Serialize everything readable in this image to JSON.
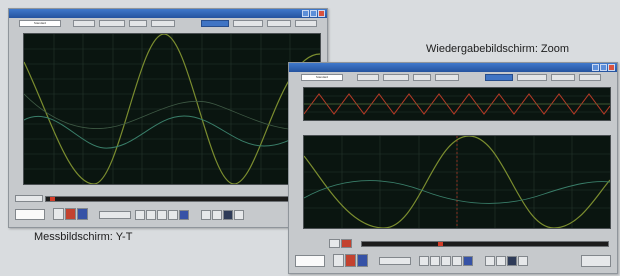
{
  "captions": {
    "measurement": "Messbildschirm: Y-T",
    "playback": "Wiedergabebildschirm: Zoom"
  },
  "colors": {
    "plot_bg": "#0a1510",
    "trace_primary": "#7b8d2f",
    "trace_secondary": "#3a7f6a",
    "trace_red": "#b83a26",
    "title_bar": "#2f63b5",
    "accent_button": "#3f74c4"
  },
  "measurement_window": {
    "toolbar": {
      "selected_tab": "Standard"
    },
    "icons": [
      "marker-icon",
      "cursor-icon",
      "display-icon",
      "record-icon",
      "stop-icon",
      "pause-icon",
      "play-icon",
      "save-icon",
      "print-icon",
      "zoom-icon",
      "settings-icon"
    ]
  },
  "playback_window": {
    "toolbar": {
      "selected_tab": "Standard"
    },
    "icons": [
      "marker-icon",
      "cursor-icon",
      "display-icon",
      "record-icon",
      "stop-icon",
      "pause-icon",
      "play-icon",
      "save-icon",
      "print-icon",
      "zoom-icon",
      "settings-icon"
    ]
  }
}
